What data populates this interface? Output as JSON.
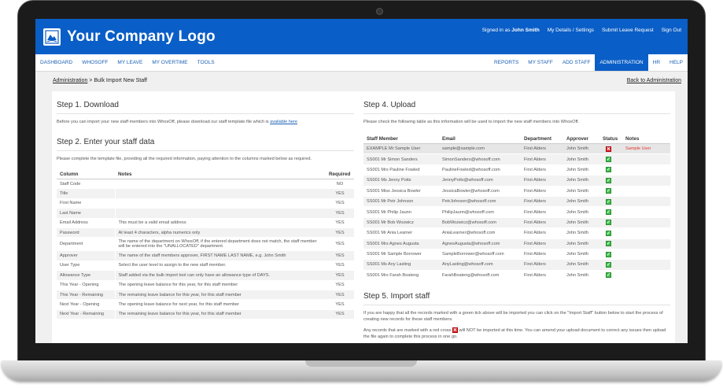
{
  "header": {
    "logo_text": "Your Company Logo",
    "signed_in_prefix": "Signed in as",
    "user_name": "John Smith",
    "links": [
      "My Details / Settings",
      "Submit Leave Request",
      "Sign Out"
    ]
  },
  "nav": {
    "left": [
      "DASHBOARD",
      "WHOSOFF",
      "MY LEAVE",
      "MY OVERTIME",
      "TOOLS"
    ],
    "right": [
      "REPORTS",
      "MY STAFF",
      "ADD STAFF",
      "ADMINISTRATION",
      "HR",
      "HELP"
    ],
    "active": "ADMINISTRATION"
  },
  "breadcrumb": {
    "root": "Administration",
    "current": " > Bulk Import New Staff",
    "back": "Back to Administration"
  },
  "step1": {
    "title": "Step 1. Download",
    "text": "Before you can import your new staff members into WhosOff, please download our staff template file which is",
    "link": "available here"
  },
  "step2": {
    "title": "Step 2. Enter your staff data",
    "text": "Please complete the template file, providing all the required information, paying attention to the columns marked below as required.",
    "headers": [
      "Column",
      "Notes",
      "Required"
    ],
    "rows": [
      {
        "column": "Staff Code",
        "notes": "",
        "required": "NO"
      },
      {
        "column": "Title",
        "notes": "",
        "required": "YES"
      },
      {
        "column": "First Name",
        "notes": "",
        "required": "YES"
      },
      {
        "column": "Last Name",
        "notes": "",
        "required": "YES"
      },
      {
        "column": "Email Address",
        "notes": "This must be a valid email address",
        "required": "YES"
      },
      {
        "column": "Password",
        "notes": "At least 4 characters, alpha numerics only",
        "required": "YES"
      },
      {
        "column": "Department",
        "notes": "The name of the department on WhosOff, if the entered department does not match, the staff member will be entered into the \"UNALLOCATED\" department.",
        "required": "YES"
      },
      {
        "column": "Approver",
        "notes": "The name of the staff members approver, FIRST NAME LAST NAME, e.g. John Smith",
        "required": "YES"
      },
      {
        "column": "User Type",
        "notes": "Select the user level to assign to the new staff member.",
        "required": "YES"
      },
      {
        "column": "Allowance Type",
        "notes": "Staff added via the bulk import tool can only have an allowance type of DAYS.",
        "required": "YES"
      },
      {
        "column": "This Year - Opening",
        "notes": "The opening leave balance for this year, for this staff member",
        "required": "YES"
      },
      {
        "column": "This Year - Remaining",
        "notes": "The remaining leave balance for this year, for this staff member",
        "required": "YES"
      },
      {
        "column": "Next Year - Opening",
        "notes": "The opening leave balance for next year, for this staff member",
        "required": "YES"
      },
      {
        "column": "Next Year - Remaining",
        "notes": "The remaining leave balance for this year, for this staff member",
        "required": "YES"
      }
    ]
  },
  "step4": {
    "title": "Step 4. Upload",
    "text": "Please check the following table as this information will be used to import the new staff members into WhosOff.",
    "headers": [
      "Staff Member",
      "Email",
      "Department",
      "Approver",
      "Status",
      "Notes"
    ],
    "rows": [
      {
        "member": "EXAMPLE Mr Sample User",
        "email": "sample@sample.com",
        "department": "First Alders",
        "approver": "John Smith",
        "status": "error",
        "notes": "Sample User"
      },
      {
        "member": "SS001 Mr Simon Sanders",
        "email": "SimonSanders@whosoff.com",
        "department": "First Alders",
        "approver": "John Smith",
        "status": "ok",
        "notes": ""
      },
      {
        "member": "SS001 Mrs Pauline Fowled",
        "email": "PaulineFowled@whosoff.com",
        "department": "First Alders",
        "approver": "John Smith",
        "status": "ok",
        "notes": ""
      },
      {
        "member": "SS001 Ms Jenny Potts",
        "email": "JennyPotts@whosoff.com",
        "department": "First Alders",
        "approver": "John Smith",
        "status": "ok",
        "notes": ""
      },
      {
        "member": "SS001 Miss Jessica Bowler",
        "email": "JessicaBowler@whosoff.com",
        "department": "First Alders",
        "approver": "John Smith",
        "status": "ok",
        "notes": ""
      },
      {
        "member": "SS001 Mr Petr Johnson",
        "email": "PetrJohnson@whosoff.com",
        "department": "First Alders",
        "approver": "John Smith",
        "status": "ok",
        "notes": ""
      },
      {
        "member": "SS001 Mr Philip Jaunn",
        "email": "PhilipJaunn@whosoff.com",
        "department": "First Alders",
        "approver": "John Smith",
        "status": "ok",
        "notes": ""
      },
      {
        "member": "SS001 Mr Bob Wozwicz",
        "email": "BobWozwicz@whosoff.com",
        "department": "First Alders",
        "approver": "John Smith",
        "status": "ok",
        "notes": ""
      },
      {
        "member": "SS001 Mr Ania Learner",
        "email": "AniaLearner@whosoff.com",
        "department": "First Alders",
        "approver": "John Smith",
        "status": "ok",
        "notes": ""
      },
      {
        "member": "SS001 Mrs Agnes Augusta",
        "email": "AgnesAugusta@whosoff.com",
        "department": "First Alders",
        "approver": "John Smith",
        "status": "ok",
        "notes": ""
      },
      {
        "member": "SS001 Mr Sample Borrower",
        "email": "SampleBorrower@whosoff.com",
        "department": "First Alders",
        "approver": "John Smith",
        "status": "ok",
        "notes": ""
      },
      {
        "member": "SS001 Ms Any Lasting",
        "email": "AnyLasting@whosoff.com",
        "department": "First Alders",
        "approver": "John Smith",
        "status": "ok",
        "notes": ""
      },
      {
        "member": "SS001 Mrs Farah Boateng",
        "email": "FarahBoateng@whosoff.com",
        "department": "First Alders",
        "approver": "John Smith",
        "status": "ok",
        "notes": ""
      }
    ]
  },
  "step5": {
    "title": "Step 5. Import staff",
    "text1": "If you are happy that all the records marked with a green tick above will be imported you can click on the \"Import Staff\" button below to start the process of creating new records for these staff members.",
    "text2_a": "Any records that are marked with a red cross",
    "text2_b": "will NOT be imported at this time. You can amend your upload document to correct any issues then upload the file again to complete this process in one go."
  },
  "colors": {
    "brand": "#0a5ec7",
    "error": "#e0342d",
    "ok": "#3ec14a"
  }
}
